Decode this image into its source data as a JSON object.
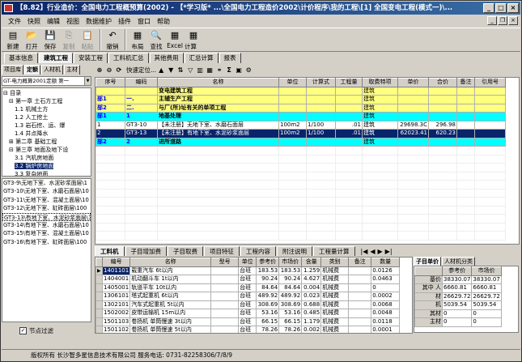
{
  "titlebar": {
    "text": "【8.82】行业造价：全国电力工程概预算(2002) - 【*学习版* ...\\全国电力工程造价2002\\计价程序\\我的工程\\[1] 全国变电工程(模式一)\\..."
  },
  "menu": [
    "文件",
    "快照",
    "编辑",
    "视图",
    "数据维护",
    "插件",
    "窗口",
    "帮助"
  ],
  "toolbar": [
    {
      "label": "新建",
      "icon": "▤",
      "enabled": true
    },
    {
      "label": "打开",
      "icon": "📂",
      "enabled": true
    },
    {
      "label": "保存",
      "icon": "💾",
      "enabled": true
    },
    {
      "label": "复制",
      "icon": "⎘",
      "enabled": false
    },
    {
      "label": "粘贴",
      "icon": "📋",
      "enabled": false
    },
    {
      "label": "撤销",
      "icon": "↶",
      "enabled": true
    },
    {
      "label": "布局",
      "icon": "▦",
      "enabled": true
    },
    {
      "label": "查找",
      "icon": "🔍",
      "enabled": true
    },
    {
      "label": "Excel",
      "icon": "▦",
      "enabled": true
    },
    {
      "label": "计算器",
      "icon": "▦",
      "enabled": true
    }
  ],
  "main_tabs": [
    "基本信息",
    "建筑工程",
    "安装工程",
    "工料机汇总",
    "其他费用",
    "汇总计算",
    "报表"
  ],
  "main_tab_active": 1,
  "left_tabs": [
    "项目库",
    "定额",
    "人材机",
    "主材"
  ],
  "left_tab_active": 1,
  "dict_selector": "GT-电力概算2001定额 第一",
  "tree": [
    {
      "indent": 0,
      "text": "⊟ 目录"
    },
    {
      "indent": 1,
      "text": "⊟ 第一章  土石方工程"
    },
    {
      "indent": 2,
      "text": "1.1 机械土方"
    },
    {
      "indent": 2,
      "text": "1.2 人工挖土"
    },
    {
      "indent": 2,
      "text": "1.3 岩石挖、运、爆"
    },
    {
      "indent": 2,
      "text": "1.4 井点降水"
    },
    {
      "indent": 1,
      "text": "⊞ 第二章  基础工程"
    },
    {
      "indent": 1,
      "text": "⊟ 第三章  地面及地下设"
    },
    {
      "indent": 2,
      "text": "3.1 汽机房地面"
    },
    {
      "indent": 2,
      "text": "3.2 锅炉房地面",
      "selected": true
    },
    {
      "indent": 2,
      "text": "3.3 复杂地面"
    }
  ],
  "quota_list": [
    {
      "text": "GT3-9\\无地下室、水泥砂浆面层\\1"
    },
    {
      "text": "GT3-10\\无地下室、水磨石面层\\10"
    },
    {
      "text": "GT3-11\\无地下室、混凝土面层\\10"
    },
    {
      "text": "GT3-12\\无地下室、缸砖面层\\100"
    },
    {
      "text": "GT3-13\\有地下室、水泥砂浆面层\\1",
      "selected": true
    },
    {
      "text": "GT3-14\\有地下室、水磨石面层\\10"
    },
    {
      "text": "GT3-15\\有地下室、混凝土面层\\10"
    },
    {
      "text": "GT3-16\\有地下室、缸砖面层\\100"
    }
  ],
  "node_filter_label": "节点过滤",
  "mini_toolbar_label": "快速定位...",
  "grid1": {
    "headers": [
      "序号",
      "编码",
      "名称",
      "单位",
      "计算式",
      "工程量",
      "取费特项",
      "单价",
      "合价",
      "备注",
      "引用号"
    ],
    "rows": [
      {
        "style": "proj",
        "seq": "",
        "code": "",
        "name": "变电建筑工程",
        "unit": "",
        "formula": "",
        "qty": "",
        "fee": "建筑",
        "price": "",
        "total": "",
        "note": "",
        "ref": ""
      },
      {
        "style": "yel",
        "seq": "部1",
        "code": "一.",
        "name": "主辅生产工程",
        "unit": "",
        "formula": "",
        "qty": "",
        "fee": "建筑",
        "price": "",
        "total": "",
        "note": "",
        "ref": ""
      },
      {
        "style": "yel",
        "seq": "部2",
        "code": "二.",
        "name": "与厂(所)址有关的单项工程",
        "unit": "",
        "formula": "",
        "qty": "",
        "fee": "建筑",
        "price": "",
        "total": "",
        "note": "",
        "ref": ""
      },
      {
        "style": "cyan",
        "seq": "部1",
        "code": "1",
        "name": "地基处理",
        "unit": "",
        "formula": "",
        "qty": "",
        "fee": "建筑",
        "price": "",
        "total": "",
        "note": "",
        "ref": ""
      },
      {
        "style": "white",
        "seq": "1",
        "code": "GT3-10",
        "name": "【未注册】无地下室、水磨石面层",
        "unit": "100m2",
        "formula": "1/100",
        "qty": ".01",
        "fee": "建筑",
        "price": "29698.3C",
        "total": "296.98",
        "note": "",
        "ref": ""
      },
      {
        "style": "sel",
        "seq": "2",
        "code": "GT3-13",
        "name": "【未注册】有地下室、水泥砂浆面层",
        "unit": "100m2",
        "formula": "1/100",
        "qty": ".01",
        "fee": "建筑",
        "price": "62023.41",
        "total": "620.23",
        "note": "",
        "ref": ""
      },
      {
        "style": "cyan",
        "seq": "部2",
        "code": "2",
        "name": "进所道路",
        "unit": "",
        "formula": "",
        "qty": "",
        "fee": "建筑",
        "price": "",
        "total": "",
        "note": "",
        "ref": ""
      }
    ]
  },
  "bottom_tabs": [
    "工料机",
    "子目增加费",
    "子目取费",
    "项目特征",
    "工程内容",
    "附注说明",
    "工程量计算"
  ],
  "bottom_tab_active": 0,
  "grid2": {
    "headers": [
      "编号",
      "名称",
      "型号",
      "单位",
      "参考价",
      "市场价",
      "含量",
      "类别",
      "备注",
      "数量"
    ],
    "rows": [
      {
        "code": "1401101",
        "name": "载重汽车  6t以内",
        "model": "",
        "unit": "台班",
        "ref": "183.53",
        "market": "183.53",
        "content": "1.259",
        "cat": "机械费",
        "note": "",
        "count": "0.0126"
      },
      {
        "code": "1404001",
        "name": "机动翻斗车  1t以内",
        "model": "",
        "unit": "台班",
        "ref": "90.24",
        "market": "90.24",
        "content": "4.627",
        "cat": "机械费",
        "note": "",
        "count": "0.0463"
      },
      {
        "code": "1405001",
        "name": "轨道平车  10t以内",
        "model": "",
        "unit": "台班",
        "ref": "84.64",
        "market": "84.64",
        "content": "0.004",
        "cat": "机械费",
        "note": "",
        "count": "0"
      },
      {
        "code": "1306101",
        "name": "塔式起重机  6t以内",
        "model": "",
        "unit": "台班",
        "ref": "489.92",
        "market": "489.92",
        "content": "0.023",
        "cat": "机械费",
        "note": "",
        "count": "0.0002"
      },
      {
        "code": "1302101",
        "name": "汽车式起重机  5t以内",
        "model": "",
        "unit": "台班",
        "ref": "308.69",
        "market": "308.69",
        "content": "0.688",
        "cat": "机械费",
        "note": "",
        "count": "0.0068"
      },
      {
        "code": "1502002",
        "name": "皮带运输机  15m以内",
        "model": "",
        "unit": "台班",
        "ref": "53.16",
        "market": "53.16",
        "content": "0.485",
        "cat": "机械费",
        "note": "",
        "count": "0.0048"
      },
      {
        "code": "1501103",
        "name": "卷扬机  单筒慢速  3t以内",
        "model": "",
        "unit": "台班",
        "ref": "66.15",
        "market": "66.15",
        "content": "1.179",
        "cat": "机械费",
        "note": "",
        "count": "0.0118"
      },
      {
        "code": "1501102",
        "name": "卷扬机  单筒慢速  5t以内",
        "model": "",
        "unit": "台班",
        "ref": "78.26",
        "market": "78.26",
        "content": "0.002",
        "cat": "机械费",
        "note": "",
        "count": "0.0001"
      }
    ]
  },
  "right_tabs": [
    "子目单价",
    "人材机分类"
  ],
  "grid3": {
    "headers": [
      "",
      "参考价",
      "市场价"
    ],
    "rows": [
      {
        "label": "基价",
        "ref": "38330.07",
        "market": "38330.07"
      },
      {
        "label": "其中  人",
        "ref": "6660.81",
        "market": "6660.81"
      },
      {
        "label": "材",
        "ref": "26629.72",
        "market": "26629.72"
      },
      {
        "label": "机",
        "ref": "5039.54",
        "market": "5039.54"
      },
      {
        "label": "其材",
        "ref": "0",
        "market": "0"
      },
      {
        "label": "主材",
        "ref": "0",
        "market": "0"
      }
    ]
  },
  "statusbar": "版权所有 长沙智多星信息技术有限公司     服务电话: 0731-82258306/7/8/9",
  "colors": {
    "selection": "#0a246a",
    "project_row": "#ffff80",
    "division_row": "#00ffff",
    "titlebar": "#0a246a"
  }
}
